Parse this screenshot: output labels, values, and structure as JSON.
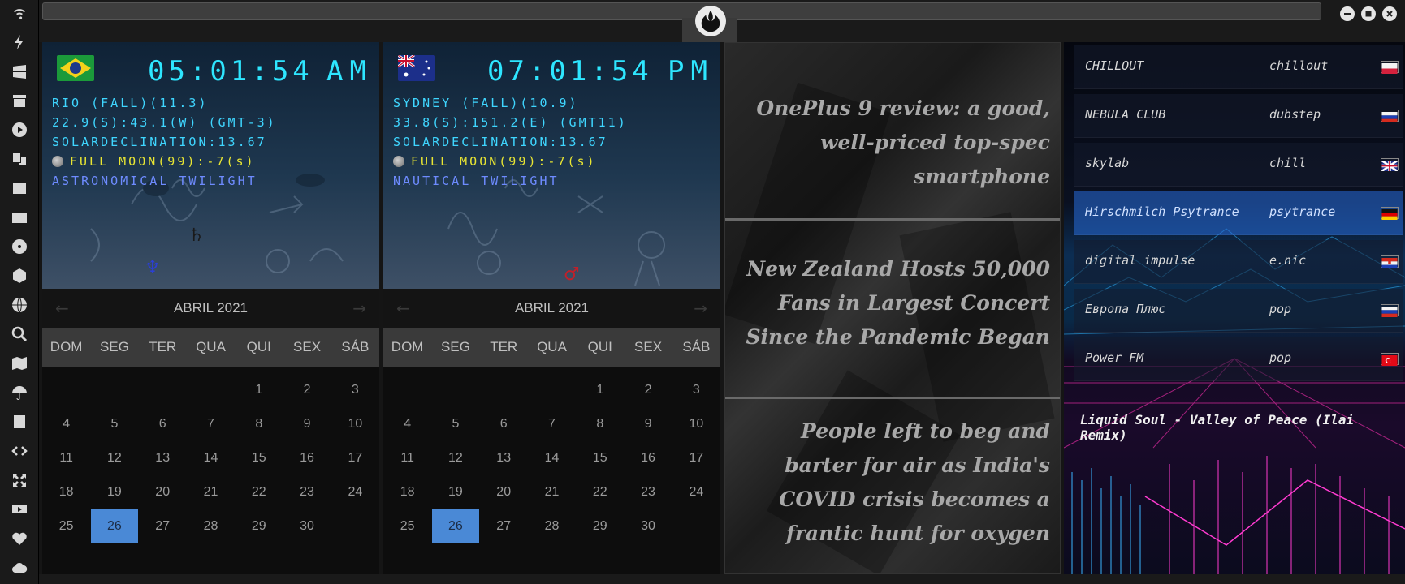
{
  "sidebar": {
    "icons": [
      "wifi-icon",
      "lightning-icon",
      "windows-icon",
      "archive-icon",
      "play-icon",
      "translate-icon",
      "image-icon",
      "news-icon",
      "radiation-icon",
      "hexagon-icon",
      "globe-icon",
      "search-icon",
      "map-icon",
      "umbrella-icon",
      "contacts-icon",
      "code-icon",
      "expand-icon",
      "youtube-icon",
      "heart-icon",
      "cloud-icon"
    ]
  },
  "clocks": [
    {
      "flag": "brazil-flag",
      "time": "05:01:54",
      "ampm": "AM",
      "lines": [
        "RIO (FALL)(11.3)",
        "22.9(S):43.1(W) (GMT-3)",
        "SOLARDECLINATION:13.67"
      ],
      "moon": "FULL MOON(99):-7(s)",
      "twilight": "ASTRONOMICAL TWILIGHT"
    },
    {
      "flag": "australia-flag",
      "time": "07:01:54",
      "ampm": "PM",
      "lines": [
        "SYDNEY (FALL)(10.9)",
        "33.8(S):151.2(E) (GMT11)",
        "SOLARDECLINATION:13.67"
      ],
      "moon": "FULL MOON(99):-7(s)",
      "twilight": "NAUTICAL TWILIGHT"
    }
  ],
  "calendars": [
    {
      "title": "ABRIL 2021",
      "prev": "←",
      "next": "→",
      "dow": [
        "DOM",
        "SEG",
        "TER",
        "QUA",
        "QUI",
        "SEX",
        "SÁB"
      ],
      "leading_blanks": 4,
      "days": [
        "1",
        "2",
        "3",
        "4",
        "5",
        "6",
        "7",
        "8",
        "9",
        "10",
        "11",
        "12",
        "13",
        "14",
        "15",
        "16",
        "17",
        "18",
        "19",
        "20",
        "21",
        "22",
        "23",
        "24",
        "25",
        "26",
        "27",
        "28",
        "29",
        "30"
      ],
      "today": "26"
    },
    {
      "title": "ABRIL 2021",
      "prev": "←",
      "next": "→",
      "dow": [
        "DOM",
        "SEG",
        "TER",
        "QUA",
        "QUI",
        "SEX",
        "SÁB"
      ],
      "leading_blanks": 4,
      "days": [
        "1",
        "2",
        "3",
        "4",
        "5",
        "6",
        "7",
        "8",
        "9",
        "10",
        "11",
        "12",
        "13",
        "14",
        "15",
        "16",
        "17",
        "18",
        "19",
        "20",
        "21",
        "22",
        "23",
        "24",
        "25",
        "26",
        "27",
        "28",
        "29",
        "30"
      ],
      "today": "26"
    }
  ],
  "news": [
    "OnePlus 9 review: a good, well-priced top-spec smartphone",
    "New Zealand Hosts 50,000 Fans in Largest Concert Since the Pandemic Began",
    "People left to beg and barter for air as India's COVID crisis becomes a frantic hunt for oxygen"
  ],
  "radio": {
    "stations": [
      {
        "name": "CHILLOUT",
        "genre": "chillout",
        "flag": "poland-flag"
      },
      {
        "name": "NEBULA CLUB",
        "genre": "dubstep",
        "flag": "russia-flag"
      },
      {
        "name": "skylab",
        "genre": "chill",
        "flag": "uk-flag"
      },
      {
        "name": "Hirschmilch Psytrance",
        "genre": "psytrance",
        "flag": "germany-flag"
      },
      {
        "name": "digital impulse",
        "genre": "e.nic",
        "flag": "croatia-flag"
      },
      {
        "name": "Европа Плюс",
        "genre": "pop",
        "flag": "russia-flag"
      },
      {
        "name": "Power FM",
        "genre": "pop",
        "flag": "turkey-flag"
      }
    ],
    "active_index": 3,
    "now_playing": "Liquid Soul - Valley of Peace (Ilai Remix)"
  },
  "colors": {
    "lcd": "#2ee6ff",
    "moon": "#e8e533",
    "twilight": "#6e8bff",
    "today": "#4a89d6"
  }
}
